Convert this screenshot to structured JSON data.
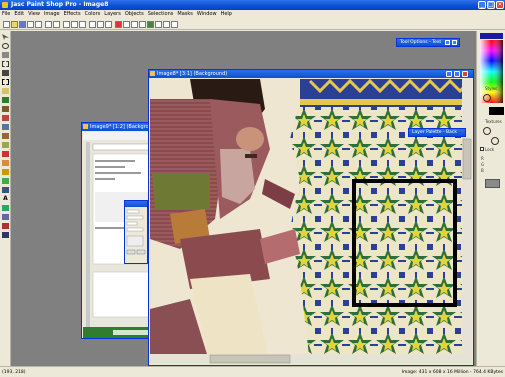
{
  "app": {
    "title": "Jasc Paint Shop Pro - Image8"
  },
  "menu": [
    "File",
    "Edit",
    "View",
    "Image",
    "Effects",
    "Colors",
    "Layers",
    "Objects",
    "Selections",
    "Masks",
    "Window",
    "Help"
  ],
  "windows": {
    "main": {
      "title": "Image8* [3:1] (Background)"
    },
    "small": {
      "title": "Image9* [1:2] (Background)"
    }
  },
  "palettes": {
    "tool_options": "Tool Options - Text",
    "layer": "Layer Palette - Back"
  },
  "right_panel": {
    "styles": "Styles",
    "textures": "Textures",
    "lock": "Lock",
    "r": "R",
    "g": "G",
    "b": "B"
  },
  "status": {
    "coords": "(193, 218)",
    "info": "Image: 431 x 608 x 16 Million - 764.4 KBytes"
  },
  "colors": {
    "accent": "#0a4fd6",
    "workspace": "#808080",
    "selection_border": "#000000"
  }
}
